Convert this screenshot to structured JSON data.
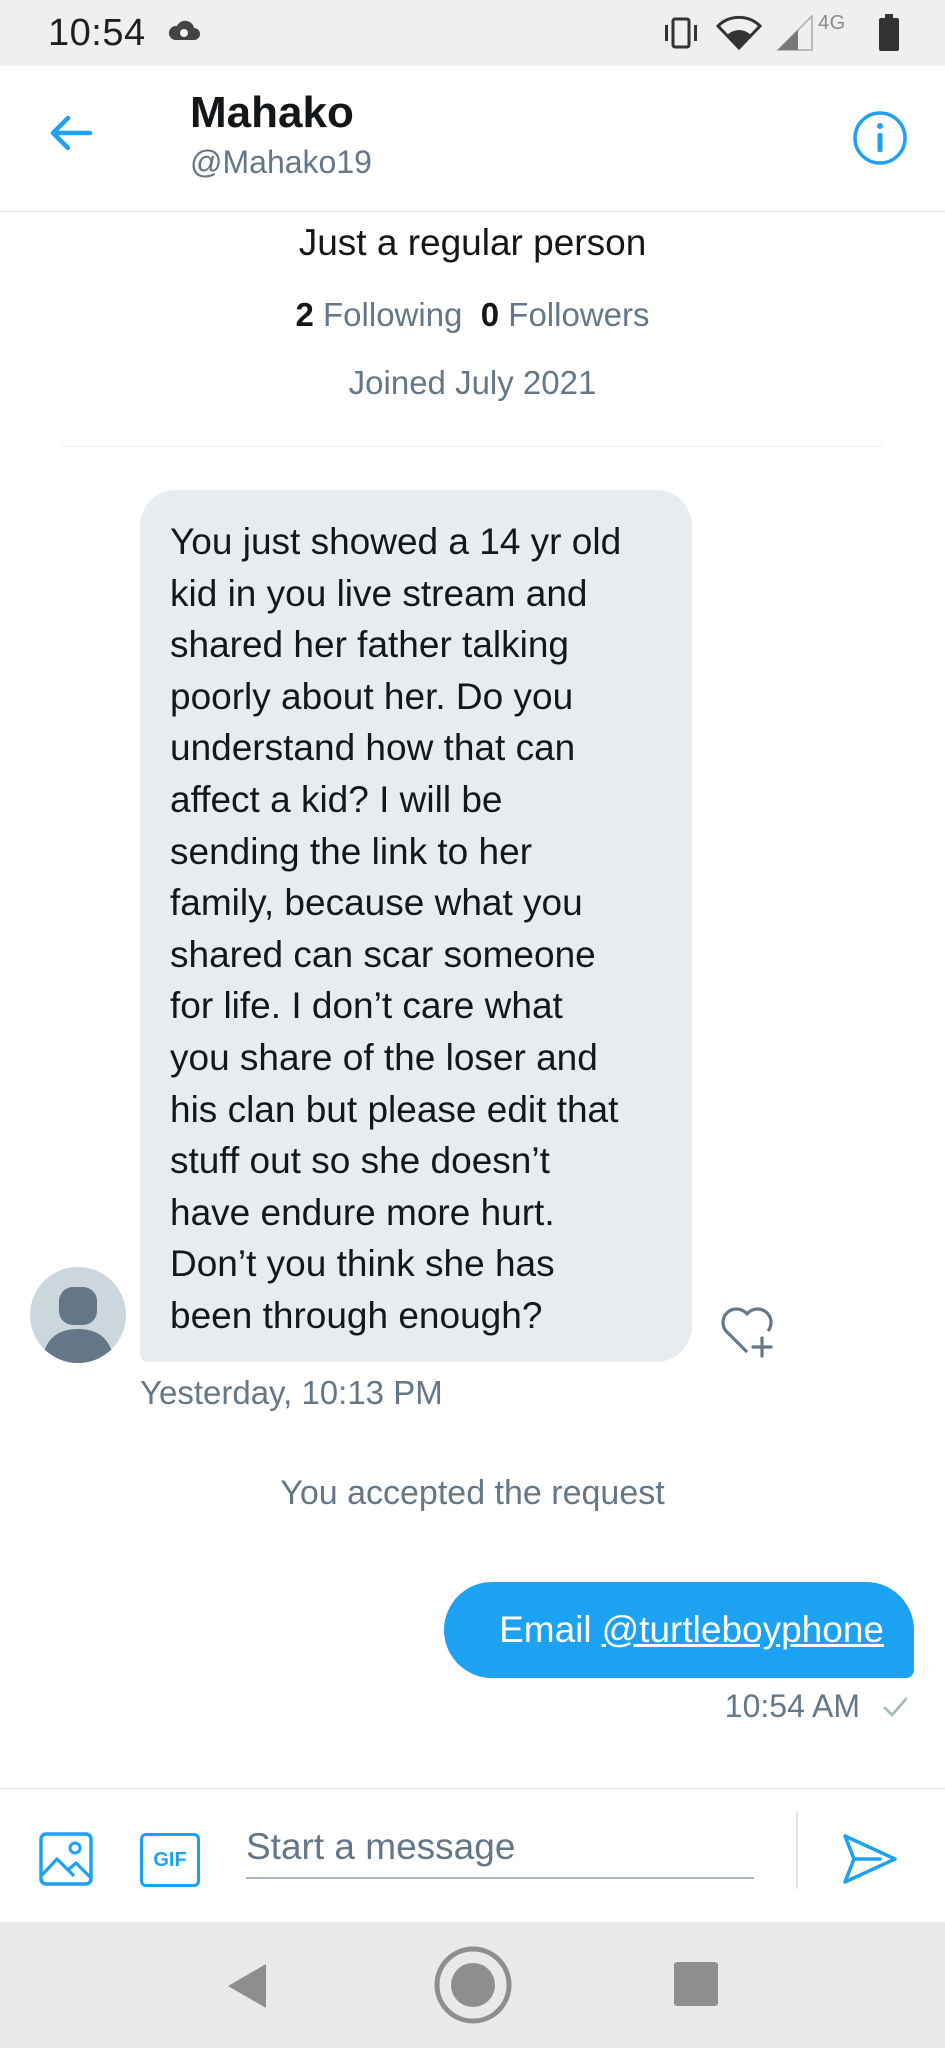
{
  "status_bar": {
    "time": "10:54",
    "network": "4G",
    "icons": [
      "cloud-icon",
      "vibrate-icon",
      "wifi-icon",
      "signal-icon",
      "battery-icon"
    ]
  },
  "header": {
    "name": "Mahako",
    "handle": "@Mahako19",
    "icons": [
      "back-arrow-icon",
      "info-icon"
    ]
  },
  "profile": {
    "bio": "Just a regular person",
    "following_count": "2",
    "following_label": "Following",
    "followers_count": "0",
    "followers_label": "Followers",
    "joined": "Joined July 2021"
  },
  "conversation": {
    "incoming": {
      "text": "You just showed a 14 yr old\nkid in you live stream and\nshared her father talking\npoorly about her.  Do you\nunderstand how that can\naffect a kid?  I will be\nsending the link to her\nfamily, because what you\nshared can scar someone\nfor life.  I don’t care what\nyou share of the loser and\nhis clan but please edit that\nstuff out so she doesn’t\nhave endure more hurt.\nDon’t you think she has\nbeen through enough?",
      "timestamp": "Yesterday, 10:13 PM"
    },
    "system_notice": "You accepted the request",
    "outgoing": {
      "prefix": "Email",
      "mention": "@turtleboyphone",
      "timestamp": "10:54 AM"
    }
  },
  "composer": {
    "placeholder": "Start a message",
    "gif_label": "GIF",
    "icons": [
      "image-icon",
      "send-icon"
    ]
  },
  "nav_bar": {
    "icons": [
      "nav-back-icon",
      "nav-home-icon",
      "nav-recents-icon"
    ]
  },
  "colors": {
    "accent": "#1da1f2",
    "secondary_text": "#657786",
    "incoming_bubble": "#e6ecf0"
  }
}
